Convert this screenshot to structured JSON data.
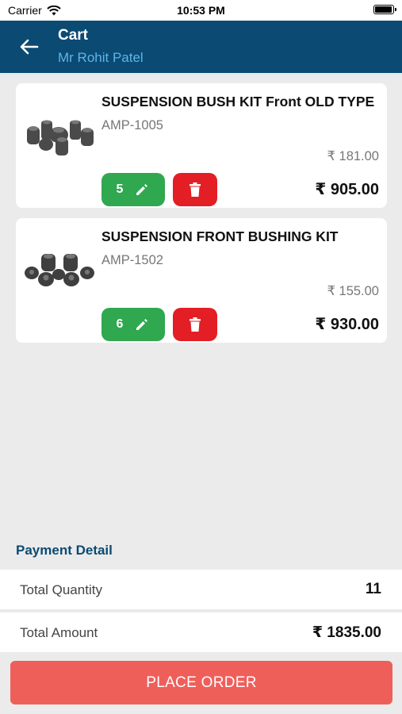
{
  "status_bar": {
    "carrier": "Carrier",
    "time": "10:53 PM"
  },
  "header": {
    "title": "Cart",
    "subtitle": "Mr Rohit Patel"
  },
  "cart_items": [
    {
      "name": "SUSPENSION BUSH KIT Front OLD TYPE",
      "code": "AMP-1005",
      "unit_price": "₹ 181.00",
      "quantity": "5",
      "total": "₹ 905.00"
    },
    {
      "name": "SUSPENSION FRONT BUSHING KIT",
      "code": "AMP-1502",
      "unit_price": "₹ 155.00",
      "quantity": "6",
      "total": "₹ 930.00"
    }
  ],
  "payment": {
    "title": "Payment Detail",
    "quantity_label": "Total Quantity",
    "quantity_value": "11",
    "amount_label": "Total Amount",
    "amount_value": "₹ 1835.00"
  },
  "place_order_label": "PLACE ORDER",
  "colors": {
    "header": "#0b4a73",
    "edit_button": "#2fa84f",
    "delete_button": "#e31e24",
    "place_order": "#ef5f5a"
  }
}
